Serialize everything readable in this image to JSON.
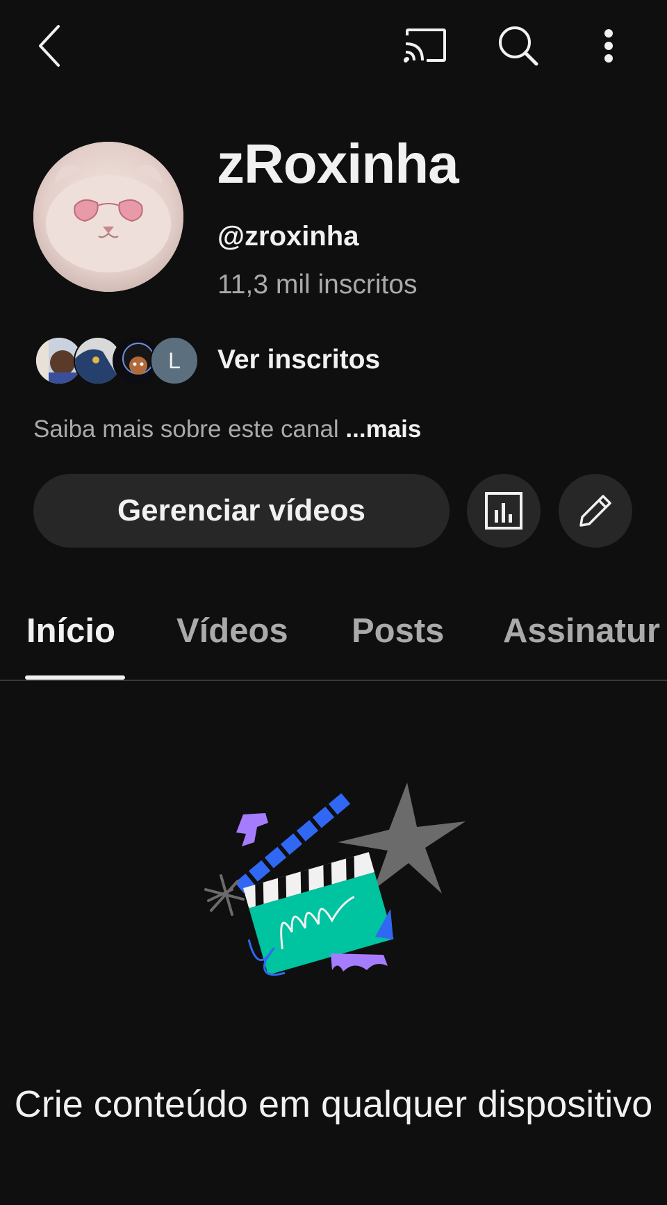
{
  "topbar": {
    "icons": [
      "back-arrow-icon",
      "cast-icon",
      "search-icon",
      "more-vert-icon"
    ]
  },
  "channel": {
    "name": "zRoxinha",
    "handle": "@zroxinha",
    "subscribers": "11,3 mil inscritos",
    "subscriber_avatar_initial": "L",
    "view_subscribers_label": "Ver inscritos",
    "about_text": "Saiba mais sobre este canal",
    "about_more": "...mais"
  },
  "actions": {
    "manage_videos_label": "Gerenciar vídeos",
    "analytics_icon": "bar-chart-icon",
    "edit_icon": "pencil-icon"
  },
  "tabs": [
    {
      "label": "Início",
      "active": true
    },
    {
      "label": "Vídeos",
      "active": false
    },
    {
      "label": "Posts",
      "active": false
    },
    {
      "label": "Assinatur",
      "active": false
    }
  ],
  "empty_state": {
    "illustration": "clapperboard-illustration",
    "title": "Crie conteúdo em qualquer dispositivo"
  },
  "colors": {
    "background": "#0f0f0f",
    "surface": "#272727",
    "text_primary": "#f1f1f1",
    "text_secondary": "#aaaaaa",
    "accent_teal": "#00c3a0",
    "accent_blue": "#3168f3",
    "accent_purple": "#a67cff"
  }
}
